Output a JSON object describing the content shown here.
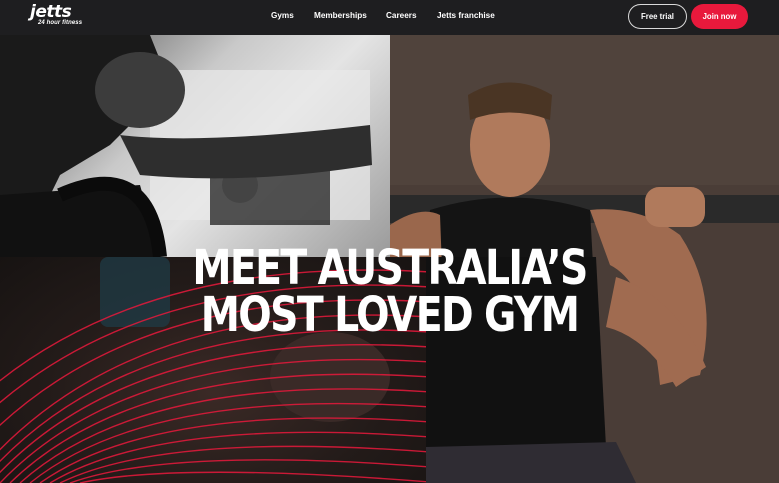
{
  "brand": {
    "name": "jetts",
    "tagline": "24 hour fitness"
  },
  "nav": {
    "links": [
      "Gyms",
      "Memberships",
      "Careers",
      "Jetts franchise"
    ]
  },
  "actions": {
    "free_trial": "Free trial",
    "join_now": "Join now"
  },
  "hero": {
    "headline_line1": "MEET AUSTRALIA’S",
    "headline_line2": "MOST LOVED GYM"
  },
  "colors": {
    "accent": "#e8193c",
    "nav_bg": "#1e1e20",
    "text": "#ffffff"
  }
}
